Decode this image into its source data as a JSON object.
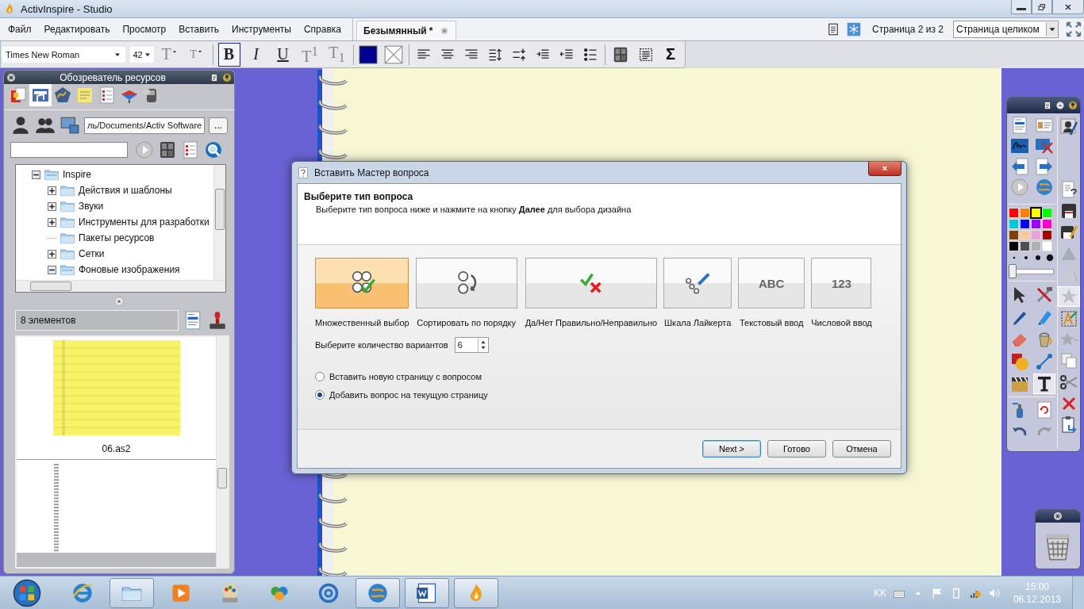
{
  "window": {
    "title": "ActivInspire - Studio"
  },
  "menu": [
    "Файл",
    "Редактировать",
    "Просмотр",
    "Вставить",
    "Инструменты",
    "Справка"
  ],
  "document_tab": {
    "label": "Безымянный *"
  },
  "page_indicator": "Страница 2 из 2",
  "zoom_select": {
    "value": "Страница целиком"
  },
  "format_toolbar": {
    "font": "Times New Roman",
    "size": "42",
    "sigma": "Σ",
    "buttons": [
      {
        "label": "T",
        "kind": "grow",
        "selected": false,
        "disabled": true
      },
      {
        "label": "T",
        "kind": "shrink",
        "selected": false,
        "disabled": true
      },
      {
        "label": "B",
        "kind": "bold",
        "selected": true,
        "disabled": false
      },
      {
        "label": "I",
        "kind": "italic",
        "selected": false,
        "disabled": false
      },
      {
        "label": "U",
        "kind": "underline",
        "selected": false,
        "disabled": false
      },
      {
        "label": "T$^{1}$",
        "kind": "superscript",
        "selected": false,
        "disabled": true
      },
      {
        "label": "T$_{1}$",
        "kind": "subscript",
        "selected": false,
        "disabled": true
      }
    ]
  },
  "resource_browser": {
    "title": "Обозреватель ресурсов",
    "path": "ль/Documents/Activ Software",
    "browse_label": "...",
    "count": "8 элементов",
    "tree": [
      {
        "label": "Inspire",
        "kind": "folder",
        "expanded": true,
        "children": [
          {
            "label": "Действия и шаблоны",
            "kind": "folder",
            "expanded": false
          },
          {
            "label": "Звуки",
            "kind": "folder",
            "expanded": false
          },
          {
            "label": "Инструменты для разработки",
            "kind": "folder",
            "expanded": false
          },
          {
            "label": "Пакеты ресурсов",
            "kind": "leaf",
            "expanded": false
          },
          {
            "label": "Сетки",
            "kind": "folder",
            "expanded": false
          },
          {
            "label": "Фоновые изображения",
            "kind": "folder",
            "expanded": true
          }
        ]
      }
    ],
    "thumbnails": [
      {
        "kind": "lined-paper",
        "label": "06.as2"
      },
      {
        "kind": "spiral"
      }
    ]
  },
  "dialog": {
    "title": "Вставить Мастер вопроса",
    "heading": "Выберите тип вопроса",
    "subtitle": "Выберите тип вопроса ниже и нажмите на кнопку **Далее** для выбора дизайна",
    "question_types": [
      {
        "label": "Множественный выбор",
        "kind": "multiple",
        "selected": true
      },
      {
        "label": "Сортировать по порядку",
        "kind": "order",
        "selected": false
      },
      {
        "label": "Да/Нет Правильно/Неправильно",
        "kind": "yesno",
        "selected": false
      },
      {
        "label": "Шкала Лайкерта",
        "kind": "likert",
        "selected": false
      },
      {
        "label": "Текстовый ввод",
        "kind": "text",
        "tile_text": "ABC",
        "selected": false
      },
      {
        "label": "Числовой ввод",
        "kind": "number",
        "tile_text": "123",
        "selected": false
      }
    ],
    "options_label": "Выберите количество вариантов",
    "options_count": "6",
    "placement": [
      {
        "label": "Вставить новую страницу с вопросом",
        "selected": false
      },
      {
        "label": "Добавить вопрос на текущую страницу",
        "selected": true
      }
    ],
    "buttons": [
      {
        "label": "Next >",
        "kind": "default"
      },
      {
        "label": "Готово",
        "kind": "normal"
      },
      {
        "label": "Отмена",
        "kind": "normal"
      }
    ]
  },
  "toolbox": {
    "palette": [
      {
        "color": "#ff0000",
        "selected": false
      },
      {
        "color": "#ff8000",
        "selected": false
      },
      {
        "color": "#ffff00",
        "selected": true
      },
      {
        "color": "#00ff00",
        "selected": false
      },
      {
        "color": "#00c8dc",
        "selected": false
      },
      {
        "color": "#0000ff",
        "selected": false
      },
      {
        "color": "#a000ff",
        "selected": false
      },
      {
        "color": "#ff00c8",
        "selected": false
      },
      {
        "color": "#804000",
        "selected": false
      },
      {
        "color": "#f8c8a0",
        "selected": false
      },
      {
        "color": "#f0a0d8",
        "selected": false
      },
      {
        "color": "#a00000",
        "selected": false
      },
      {
        "color": "#000000",
        "selected": false
      },
      {
        "color": "#505050",
        "selected": false
      },
      {
        "color": "#b0b0b0",
        "selected": false
      },
      {
        "color": "#ffffff",
        "selected": false
      }
    ],
    "width_slider": {
      "level": 0
    },
    "tools": [
      {
        "kind": "pointer",
        "selected": false
      },
      {
        "kind": "tools",
        "selected": false
      },
      {
        "kind": "pen",
        "selected": false
      },
      {
        "kind": "highlighter",
        "selected": false
      },
      {
        "kind": "eraser",
        "selected": false
      },
      {
        "kind": "fill",
        "selected": false
      },
      {
        "kind": "shapes",
        "selected": false
      },
      {
        "kind": "connector",
        "selected": false
      },
      {
        "kind": "clapper",
        "selected": false
      },
      {
        "kind": "text",
        "selected": true
      }
    ],
    "side_tools": [
      {
        "kind": "help",
        "selected": false,
        "disabled": false
      },
      {
        "kind": "save",
        "selected": false,
        "disabled": false
      },
      {
        "kind": "save-edit",
        "selected": false,
        "disabled": false
      },
      {
        "kind": "triangle",
        "selected": false,
        "disabled": true
      },
      {
        "kind": "square",
        "selected": false,
        "disabled": true
      },
      {
        "kind": "burst",
        "selected": true,
        "disabled": true
      },
      {
        "kind": "text-edit",
        "selected": false,
        "disabled": false
      },
      {
        "kind": "star",
        "selected": false,
        "disabled": true
      },
      {
        "kind": "duplicate",
        "selected": false,
        "disabled": false
      },
      {
        "kind": "cut",
        "selected": false,
        "disabled": false
      },
      {
        "kind": "delete",
        "selected": false,
        "disabled": false
      },
      {
        "kind": "paste",
        "selected": false,
        "disabled": false
      }
    ]
  },
  "taskbar": {
    "language": "KK",
    "time": "15:00",
    "date": "06.12.2013",
    "apps": [
      {
        "kind": "browser",
        "active": false
      },
      {
        "kind": "folder",
        "active": true
      },
      {
        "kind": "media",
        "active": false
      },
      {
        "kind": "paint",
        "active": false
      },
      {
        "kind": "people",
        "active": false
      },
      {
        "kind": "mail",
        "active": false
      },
      {
        "kind": "globe",
        "active": true
      },
      {
        "kind": "word",
        "active": true
      },
      {
        "kind": "flame",
        "active": true
      }
    ]
  }
}
